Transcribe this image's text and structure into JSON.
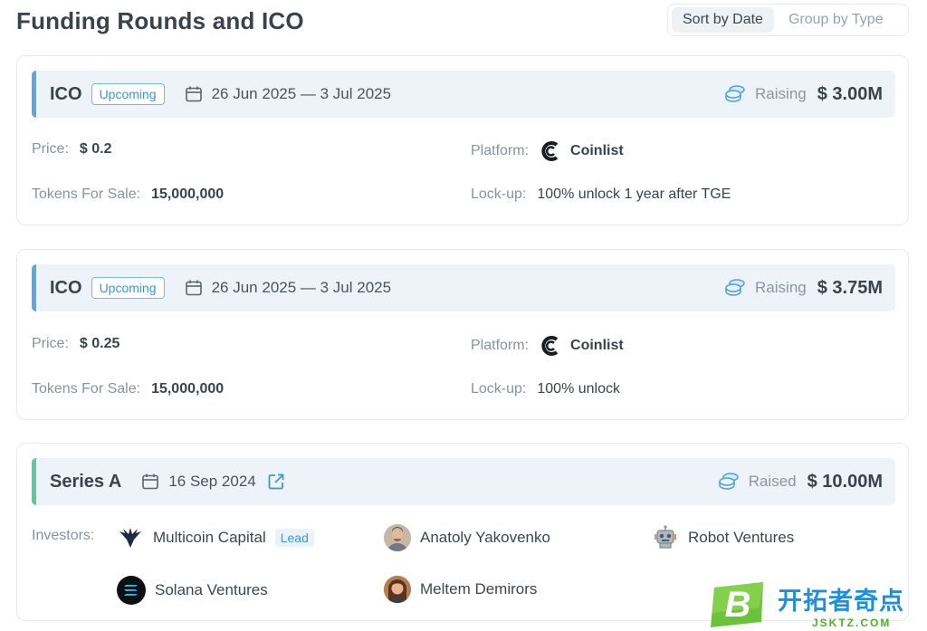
{
  "page": {
    "title": "Funding Rounds and ICO"
  },
  "sort": {
    "by_date": "Sort by Date",
    "by_type": "Group by Type"
  },
  "rounds": [
    {
      "type": "ICO",
      "status": "Upcoming",
      "date": "26 Jun 2025 — 3 Jul 2025",
      "raise_label": "Raising",
      "amount": "$ 3.00M",
      "price_label": "Price:",
      "price": "$ 0.2",
      "tokens_label": "Tokens For Sale:",
      "tokens": "15,000,000",
      "platform_label": "Platform:",
      "platform": "Coinlist",
      "lockup_label": "Lock-up:",
      "lockup": "100% unlock 1 year after TGE"
    },
    {
      "type": "ICO",
      "status": "Upcoming",
      "date": "26 Jun 2025 — 3 Jul 2025",
      "raise_label": "Raising",
      "amount": "$ 3.75M",
      "price_label": "Price:",
      "price": "$ 0.25",
      "tokens_label": "Tokens For Sale:",
      "tokens": "15,000,000",
      "platform_label": "Platform:",
      "platform": "Coinlist",
      "lockup_label": "Lock-up:",
      "lockup": "100% unlock"
    },
    {
      "type": "Series A",
      "date": "16 Sep 2024",
      "raise_label": "Raised",
      "amount": "$ 10.00M",
      "investors_label": "Investors:",
      "lead_label": "Lead",
      "investors": [
        "Multicoin Capital",
        "Anatoly Yakovenko",
        "Robot Ventures",
        "Solana Ventures",
        "Meltem Demirors"
      ]
    }
  ],
  "watermark": {
    "cn": "开拓者奇点",
    "en": "JSKTZ.COM",
    "letter": "B"
  },
  "colors": {
    "accent_blue": "#5aa8de",
    "accent_green": "#5cc7a3",
    "badge_blue": "#3f95d4"
  },
  "icons": [
    "calendar-icon",
    "coins-icon",
    "coinlist-logo-icon",
    "external-link-icon",
    "multicoin-logo-icon",
    "robot-logo-icon",
    "solana-logo-icon"
  ]
}
